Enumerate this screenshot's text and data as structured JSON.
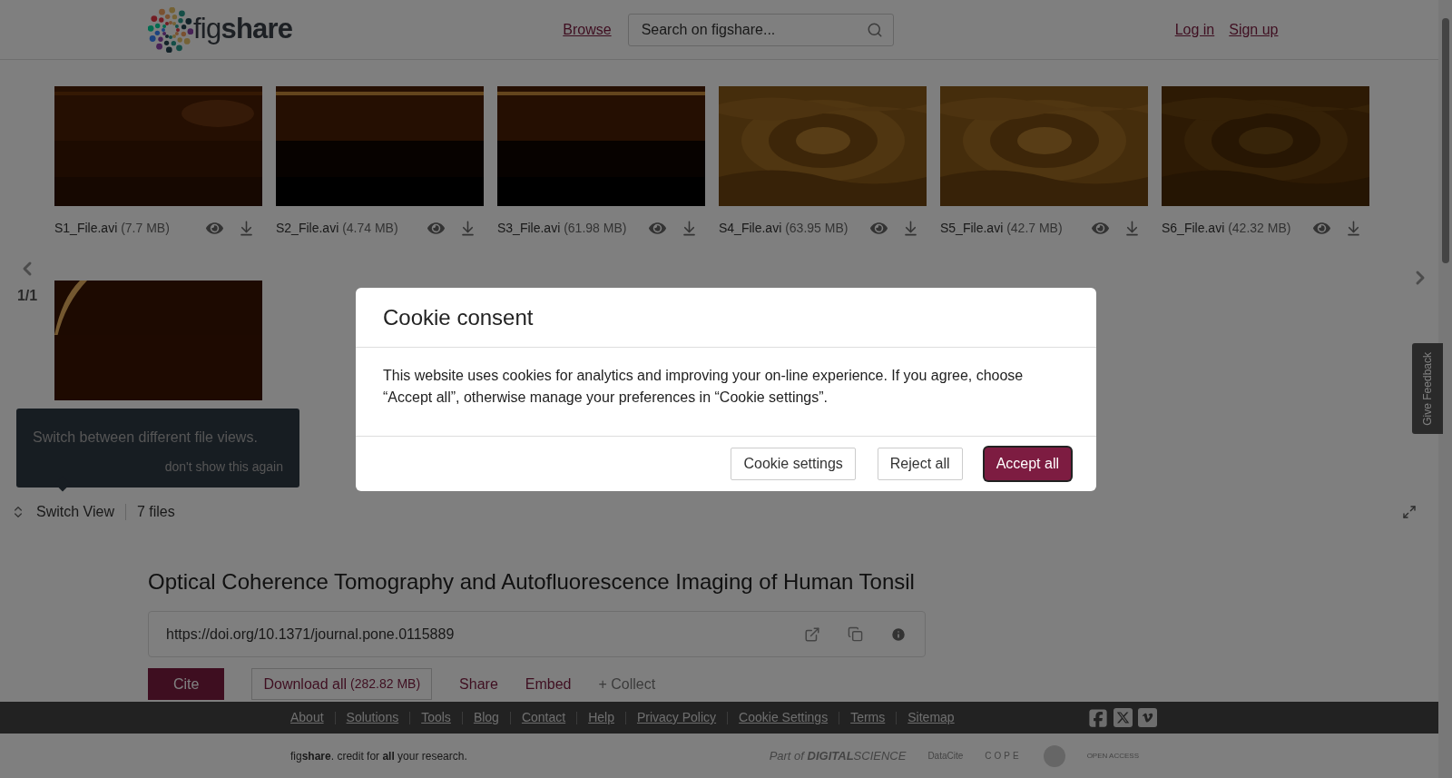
{
  "header": {
    "logo": "fig**share**",
    "nav_link": "Browse",
    "search": {
      "placeholder": "Search on figshare..."
    },
    "auth_links": [
      "Log in",
      "Sign up"
    ]
  },
  "carousel": {
    "page": "1/1",
    "files": [
      {
        "kind": "video",
        "name": "S1_File.avi",
        "size": "(7.7 MB)"
      },
      {
        "kind": "video",
        "name": "S2_File.avi",
        "size": "(4.74 MB)"
      },
      {
        "kind": "video",
        "name": "S3_File.avi",
        "size": "(61.98 MB)"
      },
      {
        "kind": "video",
        "name": "S4_File.avi",
        "size": "(63.95 MB)"
      },
      {
        "kind": "video",
        "name": "S5_File.avi",
        "size": "(42.7 MB)"
      },
      {
        "kind": "video",
        "name": "S6_File.avi",
        "size": "(42.32 MB)"
      },
      {
        "kind": "picture"
      }
    ]
  },
  "tooltip": {
    "text": "Switch between different file views.",
    "dismiss": "don't show this again"
  },
  "view_bar": {
    "switch_label": "Switch View",
    "file_count": "7 files"
  },
  "feedback_tab": "Give Feedback",
  "item": {
    "title": "Optical Coherence Tomography and Autofluorescence Imaging of Human Tonsil",
    "doi": "https://doi.org/10.1371/journal.pone.0115889",
    "actions": [
      {
        "kind": "primary",
        "label": "Cite"
      },
      {
        "kind": "outline",
        "label": "Download all",
        "detail": "(282.82 MB)"
      },
      {
        "kind": "link",
        "label": "Share"
      },
      {
        "kind": "link",
        "label": "Embed"
      },
      {
        "kind": "muted",
        "label": "+ Collect"
      }
    ]
  },
  "footer": {
    "links": [
      "About",
      "Solutions",
      "Tools",
      "Blog",
      "Contact",
      "Help",
      "Privacy Policy",
      "Cookie Settings",
      "Terms",
      "Sitemap"
    ],
    "tagline": "fig**share**. credit for **all** your research.",
    "partners": [
      "Part of **DIGITAL**SCIENCE",
      "DataCite",
      "COPE",
      "OPEN ACCESS"
    ]
  },
  "cookie_dialog": {
    "title": "Cookie consent",
    "message": "This website uses cookies for analytics and improving your on-line experience. If you agree, choose “Accept all”, otherwise manage your preferences in “Cookie settings”.",
    "buttons": [
      {
        "kind": "secondary",
        "label": "Cookie settings"
      },
      {
        "kind": "secondary",
        "label": "Reject all"
      },
      {
        "kind": "primary",
        "label": "Accept all"
      }
    ]
  }
}
